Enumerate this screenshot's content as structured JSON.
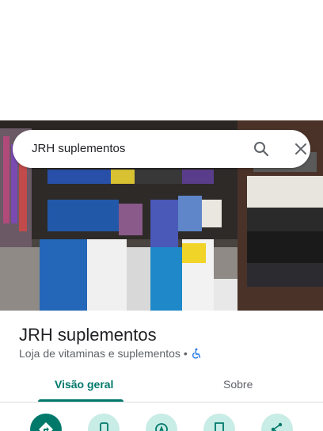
{
  "search": {
    "query": "JRH suplementos",
    "search_icon": "search-icon",
    "close_icon": "close-icon"
  },
  "place": {
    "name": "JRH suplementos",
    "category": "Loja de vitaminas e suplementos",
    "separator": "•",
    "accessibility_icon": "wheelchair-icon"
  },
  "tabs": [
    {
      "label": "Visão geral",
      "active": true
    },
    {
      "label": "Sobre",
      "active": false
    }
  ],
  "actions": [
    {
      "name": "directions",
      "icon": "directions-icon"
    },
    {
      "name": "call",
      "icon": "phone-icon"
    },
    {
      "name": "navigate",
      "icon": "navigation-icon"
    },
    {
      "name": "save",
      "icon": "bookmark-icon"
    },
    {
      "name": "share",
      "icon": "share-icon"
    }
  ],
  "colors": {
    "accent": "#00796b",
    "action_bg": "#c8ece6",
    "accessibility": "#1a73e8"
  }
}
